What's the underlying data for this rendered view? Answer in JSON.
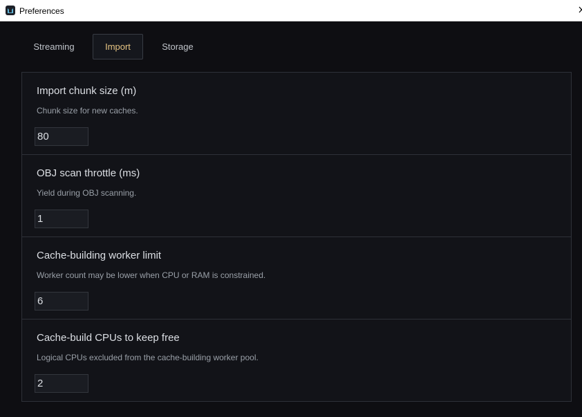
{
  "window": {
    "title": "Preferences",
    "icon": "app-icon",
    "close_icon": "close-icon"
  },
  "tabs": [
    {
      "label": "Streaming",
      "active": false
    },
    {
      "label": "Import",
      "active": true
    },
    {
      "label": "Storage",
      "active": false
    }
  ],
  "colors": {
    "active_tab_text": "#e7c584",
    "background": "#0e0e12",
    "panel": "#121318"
  },
  "settings": [
    {
      "label": "Import chunk size (m)",
      "description": "Chunk size for new caches.",
      "value": "80"
    },
    {
      "label": "OBJ scan throttle (ms)",
      "description": "Yield during OBJ scanning.",
      "value": "1"
    },
    {
      "label": "Cache-building worker limit",
      "description": "Worker count may be lower when CPU or RAM is constrained.",
      "value": "6"
    },
    {
      "label": "Cache-build CPUs to keep free",
      "description": "Logical CPUs excluded from the cache-building worker pool.",
      "value": "2"
    }
  ]
}
